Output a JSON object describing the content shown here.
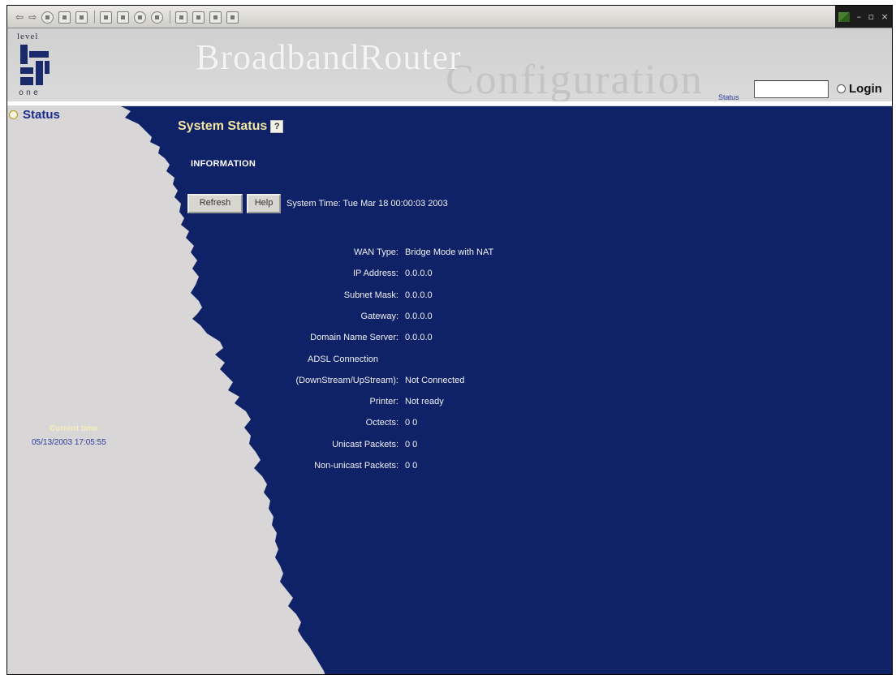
{
  "header": {
    "brand_main": "BroadbandRouter",
    "brand_sub": "Configuration",
    "logo_top": "level",
    "logo_bottom": "one",
    "status_label": "Status",
    "status_value": "",
    "login_label": "Login"
  },
  "sidebar": {
    "status_label": "Status",
    "current_time_label": "Current time",
    "current_time_value": "05/13/2003 17:05:55"
  },
  "main": {
    "title": "System Status",
    "help_glyph": "?",
    "section": "INFORMATION",
    "refresh_label": "Refresh",
    "help_label": "Help",
    "system_time": "System Time: Tue Mar 18 00:00:03 2003",
    "rows": [
      {
        "label": "WAN Type:",
        "value": "Bridge Mode with NAT"
      },
      {
        "label": "IP Address:",
        "value": "0.0.0.0"
      },
      {
        "label": "Subnet Mask:",
        "value": "0.0.0.0"
      },
      {
        "label": "Gateway:",
        "value": "0.0.0.0"
      },
      {
        "label": "Domain Name Server:",
        "value": "0.0.0.0"
      },
      {
        "label": "ADSL Connection",
        "value": ""
      },
      {
        "label": "(DownStream/UpStream):",
        "value": "Not Connected"
      },
      {
        "label": "Printer:",
        "value": "Not ready"
      },
      {
        "label": "Octects:",
        "value": "0  0"
      },
      {
        "label": "Unicast Packets:",
        "value": "0  0"
      },
      {
        "label": "Non-unicast Packets:",
        "value": "0  0"
      }
    ]
  },
  "colors": {
    "blue_bg": "#0f2167",
    "title_yellow": "#f2e7a0",
    "left_bg": "#d8d6d6"
  }
}
